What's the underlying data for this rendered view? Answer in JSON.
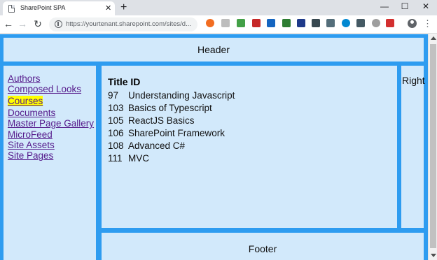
{
  "browser": {
    "tab_title": "SharePoint SPA",
    "url": "https://yourtenant.sharepoint.com/sites/d..."
  },
  "page": {
    "header": "Header",
    "right": "Right",
    "footer": "Footer",
    "nav_links": [
      "Authors",
      "Composed Looks",
      "Courses",
      "Documents",
      "Master Page Gallery",
      "MicroFeed",
      "Site Assets",
      "Site Pages"
    ],
    "active_nav": "Courses",
    "table": {
      "heading": "Title ID",
      "rows": [
        {
          "id": "97",
          "title": "Understanding Javascript"
        },
        {
          "id": "103",
          "title": "Basics of Typescript"
        },
        {
          "id": "105",
          "title": "ReactJS Basics"
        },
        {
          "id": "106",
          "title": "SharePoint Framework"
        },
        {
          "id": "108",
          "title": "Advanced C#"
        },
        {
          "id": "111",
          "title": "MVC"
        }
      ]
    }
  },
  "colors": {
    "page_background": "#2e9cf0",
    "panel_background": "#d2e9fb",
    "active_highlight": "#ffff00",
    "link_color": "#551a8b"
  }
}
